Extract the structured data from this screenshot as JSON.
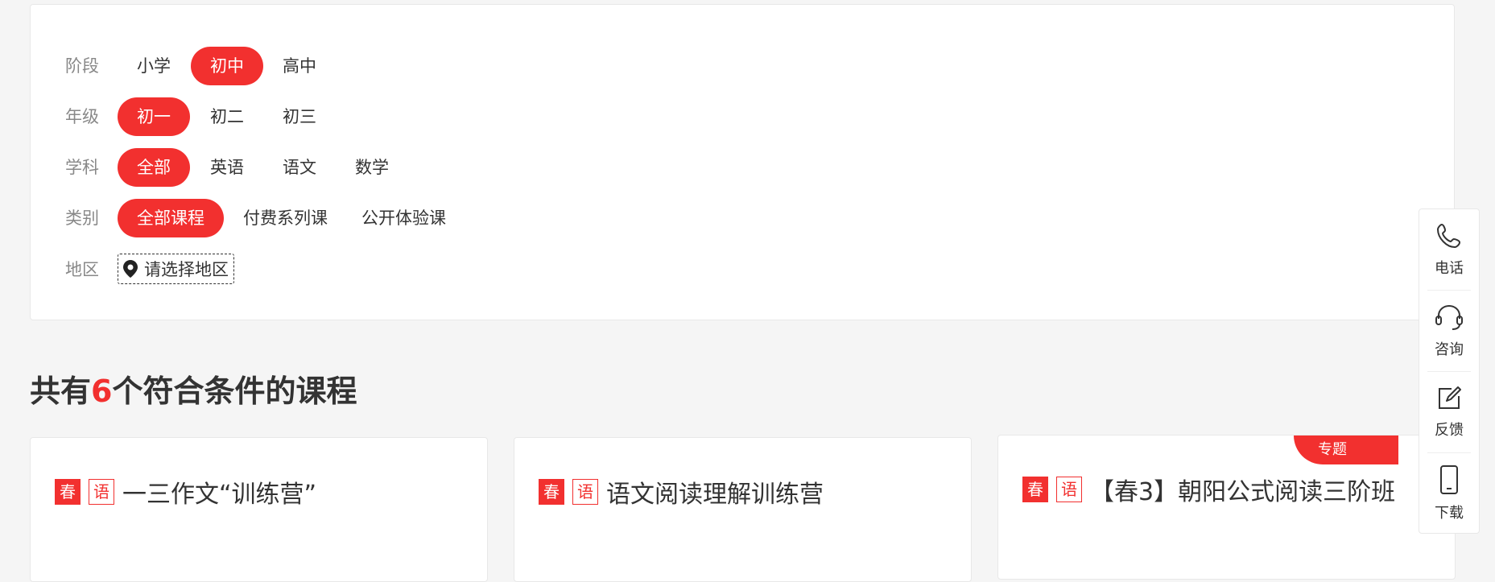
{
  "filters": {
    "stage": {
      "label": "阶段",
      "options": [
        "小学",
        "初中",
        "高中"
      ],
      "active": "初中"
    },
    "grade": {
      "label": "年级",
      "options": [
        "初一",
        "初二",
        "初三"
      ],
      "active": "初一"
    },
    "subject": {
      "label": "学科",
      "options": [
        "全部",
        "英语",
        "语文",
        "数学"
      ],
      "active": "全部"
    },
    "category": {
      "label": "类别",
      "options": [
        "全部课程",
        "付费系列课",
        "公开体验课"
      ],
      "active": "全部课程"
    },
    "region": {
      "label": "地区",
      "button_label": "请选择地区",
      "icon": "map-pin-icon"
    }
  },
  "results": {
    "prefix": "共有",
    "count": "6",
    "suffix": "个符合条件的课程"
  },
  "courses": [
    {
      "season_tag": "春",
      "subject_tag": "语",
      "title": "一三作文“训练营”"
    },
    {
      "season_tag": "春",
      "subject_tag": "语",
      "title": "语文阅读理解训练营"
    },
    {
      "season_tag": "春",
      "subject_tag": "语",
      "title": "【春3】朝阳公式阅读三阶班",
      "corner_badge": "专题"
    }
  ],
  "sidebar": {
    "items": [
      {
        "label": "电话",
        "icon": "phone-icon"
      },
      {
        "label": "咨询",
        "icon": "headset-icon"
      },
      {
        "label": "反馈",
        "icon": "edit-icon"
      },
      {
        "label": "下载",
        "icon": "mobile-icon"
      }
    ]
  },
  "colors": {
    "accent": "#f2302f",
    "text": "#333333",
    "muted": "#888888",
    "background": "#f5f5f5"
  }
}
